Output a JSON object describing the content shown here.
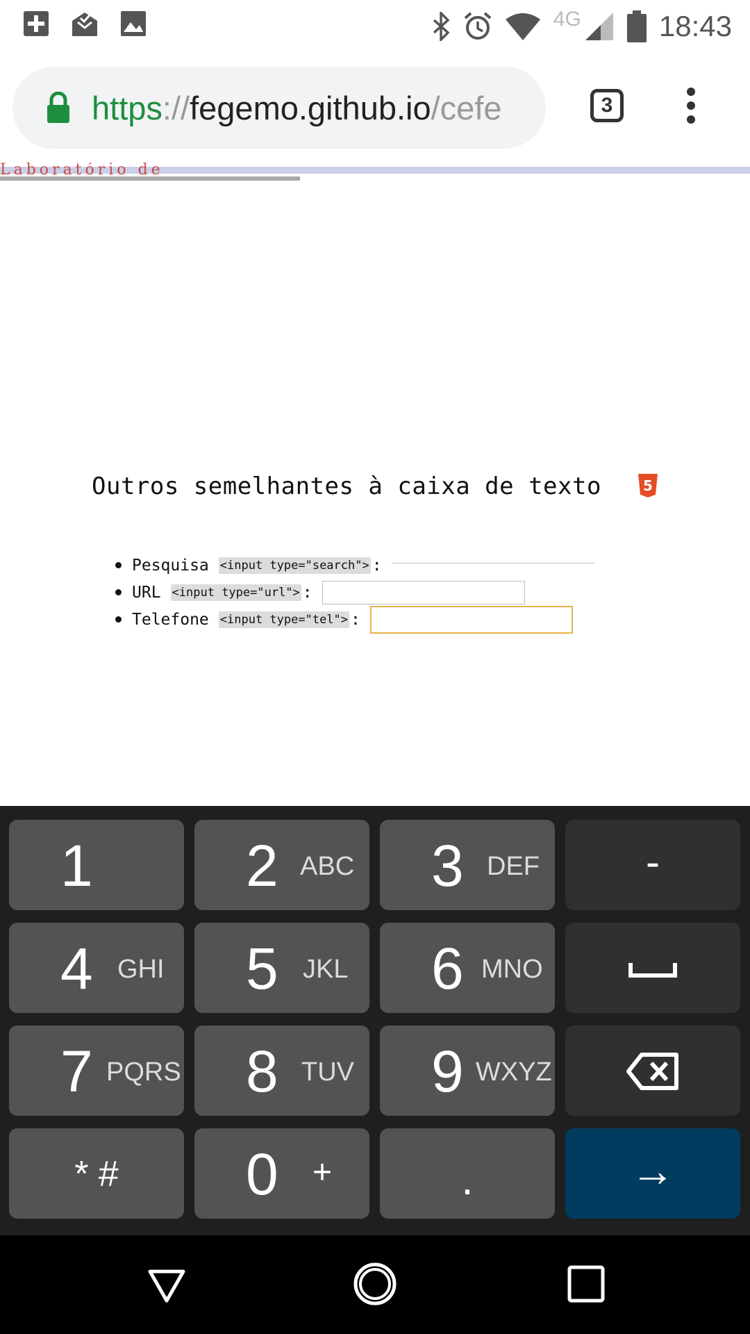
{
  "status_bar": {
    "time": "18:43",
    "network": "4G",
    "left_icons": [
      "plus-box-icon",
      "mail-open-icon",
      "image-icon"
    ],
    "right_icons": [
      "bluetooth-icon",
      "alarm-icon",
      "wifi-icon",
      "signal-icon",
      "battery-icon"
    ]
  },
  "browser": {
    "url_scheme": "https",
    "url_sep": "://",
    "url_host": "fegemo.github.io",
    "url_path": "/cefe",
    "tab_count": "3",
    "lock_color": "#1e8e3e"
  },
  "page": {
    "banner_title": "Laboratório de Programação Web",
    "heading": "Outros semelhantes à caixa de texto",
    "items": [
      {
        "label": "Pesquisa",
        "code": "<input type=\"search\">",
        "suffix": ":"
      },
      {
        "label": "URL",
        "code": "<input type=\"url\">",
        "suffix": ":"
      },
      {
        "label": "Telefone",
        "code": "<input type=\"tel\">",
        "suffix": ":"
      }
    ]
  },
  "keyboard": {
    "keys": [
      {
        "digit": "1",
        "letters": ""
      },
      {
        "digit": "2",
        "letters": "ABC"
      },
      {
        "digit": "3",
        "letters": "DEF"
      },
      {
        "symbol": "-"
      },
      {
        "digit": "4",
        "letters": "GHI"
      },
      {
        "digit": "5",
        "letters": "JKL"
      },
      {
        "digit": "6",
        "letters": "MNO"
      },
      {
        "symbol": "␣"
      },
      {
        "digit": "7",
        "letters": "PQRS"
      },
      {
        "digit": "8",
        "letters": "TUV"
      },
      {
        "digit": "9",
        "letters": "WXYZ"
      },
      {
        "symbol": "⌫"
      },
      {
        "symbol": "* #"
      },
      {
        "digit": "0",
        "letters": "+"
      },
      {
        "symbol": "."
      },
      {
        "symbol": "→"
      }
    ],
    "enter_color": "#003c5f"
  },
  "nav_bar": {
    "icons": [
      "back-triangle-icon",
      "home-circle-icon",
      "recents-square-icon"
    ]
  }
}
